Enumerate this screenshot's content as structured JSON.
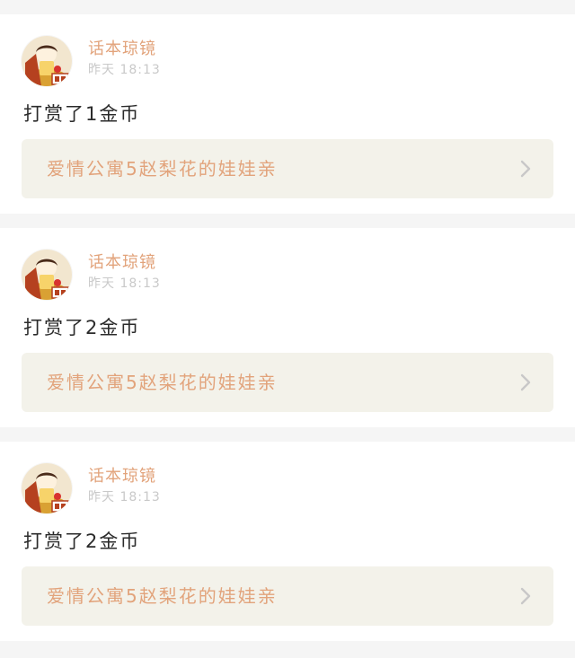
{
  "feed": {
    "items": [
      {
        "username": "话本琼镜",
        "time": "昨天 18:13",
        "message": "打赏了1金币",
        "link_title": "爱情公寓5赵梨花的娃娃亲",
        "icons": {
          "avatar": "avatar-icon",
          "chevron": "chevron-right-icon"
        }
      },
      {
        "username": "话本琼镜",
        "time": "昨天 18:13",
        "message": "打赏了2金币",
        "link_title": "爱情公寓5赵梨花的娃娃亲",
        "icons": {
          "avatar": "avatar-icon",
          "chevron": "chevron-right-icon"
        }
      },
      {
        "username": "话本琼镜",
        "time": "昨天 18:13",
        "message": "打赏了2金币",
        "link_title": "爱情公寓5赵梨花的娃娃亲",
        "icons": {
          "avatar": "avatar-icon",
          "chevron": "chevron-right-icon"
        }
      }
    ]
  },
  "colors": {
    "background": "#f5f5f5",
    "card": "#ffffff",
    "accent": "#e2a37b",
    "muted": "#c9c9c9",
    "text": "#2b2b2b",
    "link_bg": "#f3f2ea",
    "chevron": "#c8c8c8"
  }
}
